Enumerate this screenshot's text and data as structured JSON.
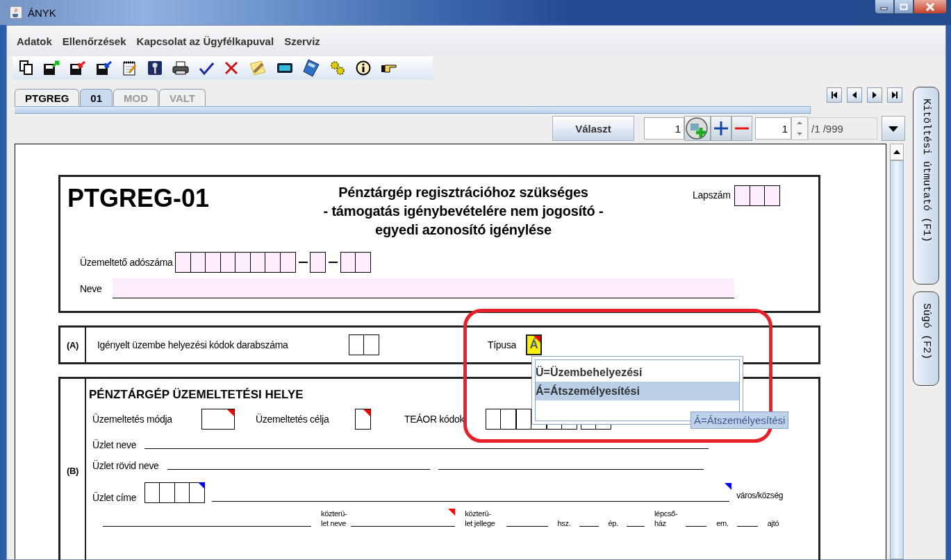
{
  "window": {
    "title": "ÁNYK"
  },
  "menu": [
    "Adatok",
    "Ellenőrzések",
    "Kapcsolat az Ügyfélkapuval",
    "Szerviz"
  ],
  "tabs": [
    {
      "label": "PTGREG",
      "selected": false,
      "disabled": false
    },
    {
      "label": "01",
      "selected": true,
      "disabled": false
    },
    {
      "label": "MOD",
      "selected": false,
      "disabled": true
    },
    {
      "label": "VALT",
      "selected": false,
      "disabled": true
    }
  ],
  "nav": {
    "choose_button": "Választ",
    "page_value": "1",
    "count_value": "1",
    "count_total": "/1 /999"
  },
  "side_tabs": [
    "Kitöltési útmutató (F1)",
    "Súgó (F2)"
  ],
  "form": {
    "code": "PTGREG-01",
    "title_lines": [
      "Pénztárgép regisztrációhoz szükséges",
      "- támogatás igénybevételére nem jogosító -",
      "egyedi azonosító igénylése"
    ],
    "sheet_label": "Lapszám",
    "tax_label": "Üzemeltető adószáma",
    "name_label": "Neve"
  },
  "section_a": {
    "mark": "(A)",
    "count_label": "Igényelt üzembe helyezési kódok darabszáma",
    "type_label": "Típusa",
    "type_value": "Á",
    "type_marked": true
  },
  "dropdown": {
    "options": [
      {
        "label": "Ü=Üzembehelyezési",
        "selected": false
      },
      {
        "label": "Á=Átszemélyesítési",
        "selected": true
      }
    ],
    "tooltip": "Á=Átszemélyesítési"
  },
  "section_b": {
    "mark": "(B)",
    "heading": "PÉNZTÁRGÉP ÜZEMELTETÉSI HELYE",
    "mode": {
      "label": "Üzemeltetés módja",
      "marked": true
    },
    "purpose": {
      "label": "Üzemeltetés célja",
      "marked": true
    },
    "teaor_label": "TEÁOR kódok",
    "shop_name_label": "Üzlet neve",
    "short_name_label": "Üzlet rövid neve",
    "address_label": "Üzlet címe",
    "postcode_marked": true,
    "city_label": "város/község",
    "city_marked": true,
    "street": [
      {
        "label": "közterü-\nlet neve",
        "marked": false
      },
      {
        "label": "közterü-\nlet jellege",
        "marked": true
      },
      {
        "label": "hsz.",
        "marked": false
      },
      {
        "label": "ép.",
        "marked": false
      },
      {
        "label": "lépcső-\nház",
        "marked": false
      },
      {
        "label": "em.",
        "marked": false
      },
      {
        "label": "ajtó",
        "marked": false
      }
    ]
  }
}
